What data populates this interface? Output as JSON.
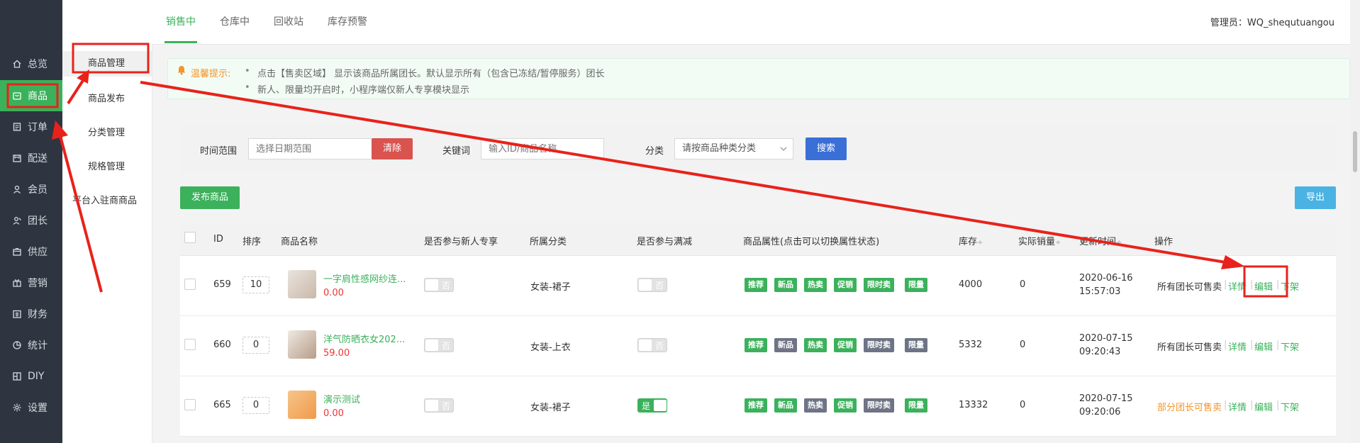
{
  "sidebar": {
    "items": [
      {
        "label": "总览",
        "icon": "home-icon"
      },
      {
        "label": "商品",
        "icon": "goods-icon"
      },
      {
        "label": "订单",
        "icon": "order-icon"
      },
      {
        "label": "配送",
        "icon": "delivery-icon"
      },
      {
        "label": "会员",
        "icon": "member-icon"
      },
      {
        "label": "团长",
        "icon": "leader-icon"
      },
      {
        "label": "供应",
        "icon": "supply-icon"
      },
      {
        "label": "营销",
        "icon": "gift-icon"
      },
      {
        "label": "财务",
        "icon": "finance-icon"
      },
      {
        "label": "统计",
        "icon": "chart-icon"
      },
      {
        "label": "DIY",
        "icon": "diy-icon"
      },
      {
        "label": "设置",
        "icon": "gear-icon"
      }
    ]
  },
  "subnav": {
    "items": [
      "商品管理",
      "商品发布",
      "分类管理",
      "规格管理",
      "平台入驻商商品"
    ]
  },
  "tabs": [
    "销售中",
    "仓库中",
    "回收站",
    "库存预警"
  ],
  "admin": {
    "label": "管理员：",
    "name": "WQ_shequtuangou"
  },
  "notice": {
    "title": "温馨提示:",
    "lines": [
      "点击【售卖区域】 显示该商品所属团长。默认显示所有（包含已冻结/暂停服务）团长",
      "新人、限量均开启时，小程序端仅新人专享模块显示"
    ]
  },
  "filter": {
    "time_label": "时间范围",
    "date_placeholder": "选择日期范围",
    "clear": "清除",
    "keyword_label": "关键词",
    "keyword_placeholder": "输入ID/商品名称",
    "category_label": "分类",
    "category_value": "请按商品种类分类",
    "search": "搜索"
  },
  "actions": {
    "publish": "发布商品",
    "export": "导出"
  },
  "table": {
    "headers": {
      "id": "ID",
      "sort": "排序",
      "name": "商品名称",
      "newbie": "是否参与新人专享",
      "category": "所属分类",
      "fullcut": "是否参与满减",
      "attrs": "商品属性(点击可以切换属性状态)",
      "stock": "库存",
      "sales": "实际销量",
      "time": "更新时间",
      "ops": "操作"
    },
    "sort_arrow": "÷",
    "attr_names": [
      "推荐",
      "新品",
      "热卖",
      "促销",
      "限时卖",
      "限量"
    ],
    "toggle_off": "否",
    "toggle_on": "是",
    "ops_detail": "详情",
    "ops_edit": "编辑",
    "ops_down": "下架",
    "ops_sep": "|",
    "rows": [
      {
        "id": "659",
        "sort": "10",
        "name": "一字肩性感网纱连...",
        "price": "0.00",
        "newbie": false,
        "category": "女装-裙子",
        "fullcut": false,
        "attrs": [
          true,
          true,
          true,
          true,
          true,
          true
        ],
        "stock": "4000",
        "sales": "0",
        "date": "2020-06-16",
        "time": "15:57:03",
        "sale_scope": "所有团长可售卖",
        "scope_color": "#333333"
      },
      {
        "id": "660",
        "sort": "0",
        "name": "洋气防晒衣女202...",
        "price": "59.00",
        "newbie": false,
        "category": "女装-上衣",
        "fullcut": false,
        "attrs": [
          true,
          false,
          true,
          true,
          false,
          false
        ],
        "stock": "5332",
        "sales": "0",
        "date": "2020-07-15",
        "time": "09:20:43",
        "sale_scope": "所有团长可售卖",
        "scope_color": "#333333"
      },
      {
        "id": "665",
        "sort": "0",
        "name": "演示测试",
        "price": "0.00",
        "newbie": false,
        "category": "女装-裙子",
        "fullcut": true,
        "attrs": [
          true,
          true,
          false,
          true,
          false,
          true
        ],
        "stock": "13332",
        "sales": "0",
        "date": "2020-07-15",
        "time": "09:20:06",
        "sale_scope": "部分团长可售卖",
        "scope_color": "#f0962e"
      }
    ]
  },
  "colors": {
    "accent": "#3bb15b",
    "danger": "#d9534f",
    "primary": "#3a6fd8",
    "info": "#4ab3e3",
    "annotation": "#e8221b"
  }
}
